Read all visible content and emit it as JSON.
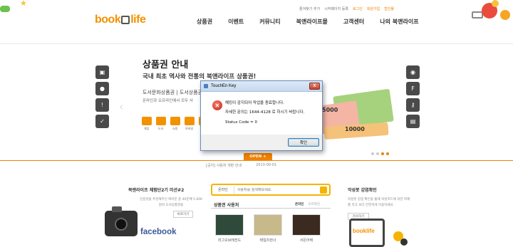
{
  "header": {
    "logo_left": "book",
    "logo_right": "life",
    "util_links": [
      "즐겨찾기 추가",
      "시작페이지 등록",
      "로그인",
      "회원가입",
      "법인몰"
    ],
    "nav": [
      "상품권",
      "이벤트",
      "커뮤니티",
      "북앤라이프몰",
      "고객센터",
      "나의 북앤라이프"
    ]
  },
  "hero": {
    "title": "상품권 안내",
    "subtitle": "국내 최초 역사와 전통의 북앤라이프 상품권!",
    "desc_line1": "도서문화상품권 | 도서상품권",
    "desc_line2": "온라인과 오프라인에서 모두 사",
    "categories": [
      "게임",
      "도서",
      "쇼핑",
      "모바일",
      "영화"
    ],
    "card_value_1": "5000",
    "card_value_2": "10000",
    "open_label": "OPEN",
    "notice_text": "[공지] 사용처 개편 안내",
    "notice_date": "2013-00-01"
  },
  "dialog": {
    "title": "TouchEn Key",
    "close": "X",
    "line1": "해킹이 감지되어 작업을 종료합니다.",
    "line2": "자세한 문의는 1644-4128 로 하시기 바랍니다.",
    "line3": "Status Code = 0",
    "ok_label": "확인"
  },
  "mission": {
    "title": "북앤라이프 체험단2기 미션#2",
    "desc": "인증샷을 추천해주신 여러분 중 40분께 5,000원의 도서상품권을",
    "button": "바로가기",
    "facebook": "facebook"
  },
  "search": {
    "select": "온라인",
    "placeholder": "사용처를 검색해보세요.",
    "section_title": "상품권 사용처",
    "tab_on": "온라인",
    "tab_off": "오프라인",
    "places": [
      "리그오브레전드",
      "테일즈런너",
      "서든어택"
    ]
  },
  "mobile": {
    "title": "악성봇 감염확인",
    "desc": "악성봇 감염 확인을 통해 악성코드에 의한 피해를 막고 보다 안전하게 이용하세요.",
    "button": "검사하기",
    "logo": "booklife"
  }
}
